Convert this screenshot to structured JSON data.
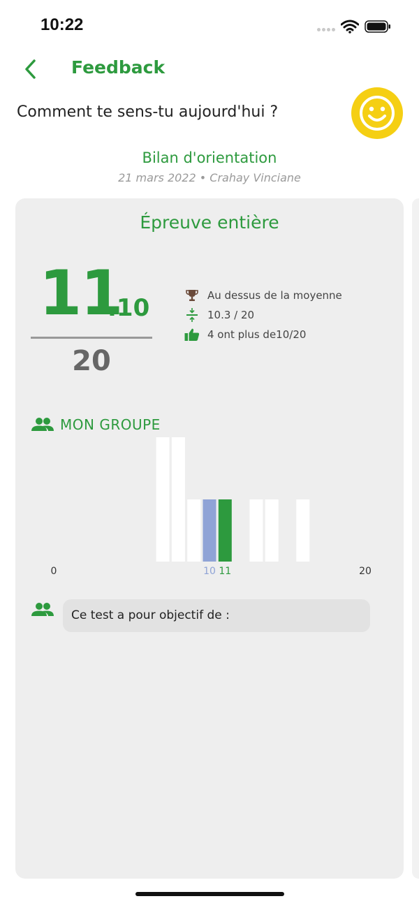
{
  "status": {
    "time": "10:22"
  },
  "header": {
    "title": "Feedback"
  },
  "mood": {
    "question": "Comment te sens-tu aujourd'hui ?"
  },
  "test": {
    "title": "Bilan d'orientation",
    "meta": "21 mars 2022 • Crahay Vinciane"
  },
  "card": {
    "section_title": "Épreuve entière",
    "score": {
      "integer": "11",
      "decimal": ".10",
      "max": "20"
    },
    "stats": [
      {
        "icon": "trophy-icon",
        "text": "Au dessus de la moyenne"
      },
      {
        "icon": "average-icon",
        "text": "10.3 / 20"
      },
      {
        "icon": "thumbs-up-icon",
        "text": "4 ont plus de10/20"
      }
    ],
    "group": {
      "label": "MON GROUPE",
      "icon": "group-icon"
    },
    "description": "Ce test a pour objectif de :"
  },
  "chart_data": {
    "type": "bar",
    "title": "",
    "xlim": [
      0,
      20
    ],
    "x_tick_labels": [
      "0",
      "20"
    ],
    "bars": [
      {
        "x": 7,
        "value": 2,
        "kind": "other"
      },
      {
        "x": 8,
        "value": 2,
        "kind": "other"
      },
      {
        "x": 9,
        "value": 1,
        "kind": "other"
      },
      {
        "x": 10,
        "value": 1,
        "kind": "average"
      },
      {
        "x": 11,
        "value": 1,
        "kind": "score"
      },
      {
        "x": 13,
        "value": 1,
        "kind": "other"
      },
      {
        "x": 14,
        "value": 1,
        "kind": "other"
      },
      {
        "x": 16,
        "value": 1,
        "kind": "other"
      }
    ],
    "markers": [
      {
        "label": "10",
        "x": 10,
        "kind": "average"
      },
      {
        "label": "11",
        "x": 11,
        "kind": "score"
      }
    ],
    "ylim": [
      0,
      2
    ],
    "colors": {
      "other": "#ffffff",
      "average": "#8fa3d6",
      "score": "#2d9a3e"
    }
  },
  "colors": {
    "accent": "#2d9a3e",
    "smiley": "#f5cf13",
    "card": "#eeeeee"
  }
}
